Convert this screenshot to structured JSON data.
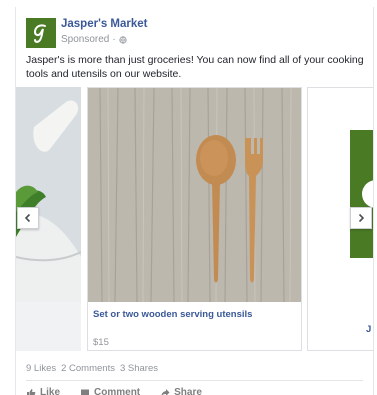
{
  "post": {
    "page_name": "Jasper's Market",
    "sponsored_label": "Sponsored",
    "separator": "·",
    "text": "Jasper's is more than just groceries! You can now find all of your cooking tools and utensils on our website."
  },
  "carousel": {
    "items": [
      {
        "title": "Set or two wooden serving utensils",
        "price": "$15"
      },
      {
        "title": "J"
      }
    ]
  },
  "engagement": {
    "likes": "9 Likes",
    "comments": "2 Comments",
    "shares": "3 Shares"
  },
  "actions": {
    "like": "Like",
    "comment": "Comment",
    "share": "Share"
  },
  "colors": {
    "brand_green": "#4a7a24",
    "link_blue": "#3b5998",
    "muted": "#90949c"
  },
  "icons": [
    "brand-logo-icon",
    "globe-icon",
    "chevron-left-icon",
    "chevron-right-icon",
    "like-icon",
    "comment-icon",
    "share-icon"
  ]
}
